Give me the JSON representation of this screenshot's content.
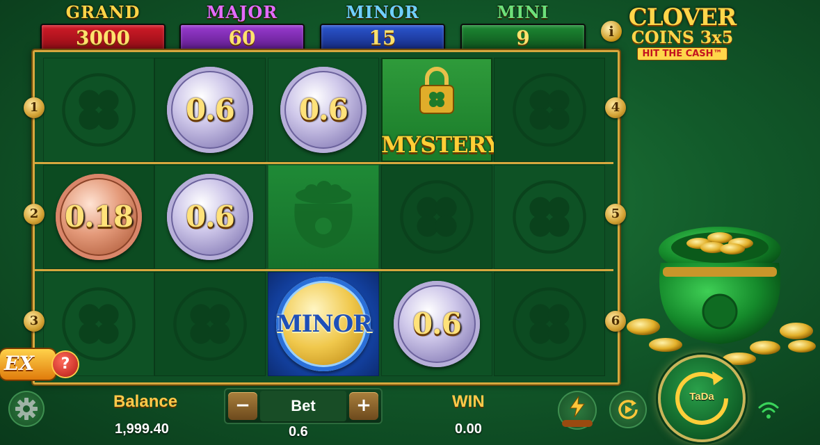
{
  "jackpots": [
    {
      "name": "GRAND",
      "value": "3000",
      "name_color": "#ffd447",
      "panel_color": "#b4141f"
    },
    {
      "name": "MAJOR",
      "value": "60",
      "name_color": "#e36cff",
      "panel_color": "#7a2aa8"
    },
    {
      "name": "MINOR",
      "value": "15",
      "name_color": "#6fd0ff",
      "panel_color": "#1b3ea8"
    },
    {
      "name": "MINI",
      "value": "9",
      "name_color": "#6de07a",
      "panel_color": "#146a26"
    }
  ],
  "logo": {
    "line1": "CLOVER",
    "line2": "COINS 3x5",
    "line3": "HIT THE CASH™"
  },
  "info_label": "i",
  "paylines_left": [
    "1",
    "2",
    "3"
  ],
  "paylines_right": [
    "4",
    "5",
    "6"
  ],
  "grid": {
    "row1": [
      "",
      "0.6",
      "0.6",
      "MYSTERY",
      ""
    ],
    "row2": [
      "0.18",
      "0.6",
      "",
      "",
      ""
    ],
    "row3": [
      "",
      "",
      "MINOR",
      "0.6",
      ""
    ]
  },
  "bottom": {
    "balance_label": "Balance",
    "balance_value": "1,999.40",
    "bet_label": "Bet",
    "bet_value": "0.6",
    "minus": "−",
    "plus": "+",
    "win_label": "WIN",
    "win_value": "0.00",
    "spin_label": "TaDa"
  },
  "ex_label": "EX",
  "help_label": "?",
  "icons": {
    "settings": "gear-icon",
    "turbo": "lightning-icon",
    "autoplay": "autoplay-icon",
    "wifi": "wifi-icon",
    "lock": "lock-icon",
    "pot": "pot-of-gold-icon"
  }
}
